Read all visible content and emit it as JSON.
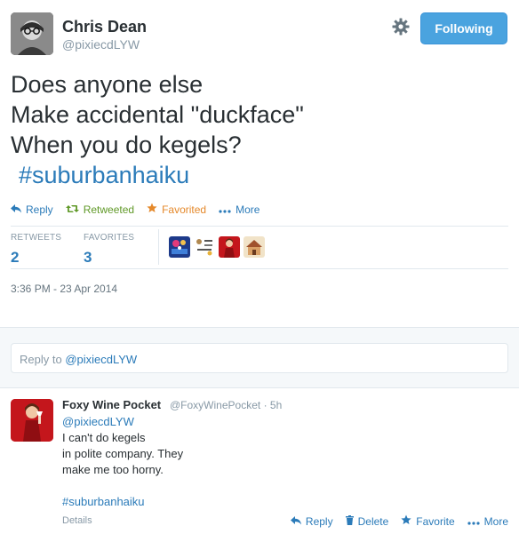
{
  "tweet": {
    "author_name": "Chris Dean",
    "author_handle": "@pixiecdLYW",
    "follow_label": "Following",
    "text_lines": [
      "Does anyone else",
      "Make accidental \"duckface\"",
      "When you do kegels?"
    ],
    "hashtag": "#suburbanhaiku",
    "actions": {
      "reply": "Reply",
      "retweet": "Retweeted",
      "favorite": "Favorited",
      "more": "More"
    },
    "stats": {
      "retweets_label": "RETWEETS",
      "retweets_count": "2",
      "favorites_label": "FAVORITES",
      "favorites_count": "3"
    },
    "timestamp": "3:36 PM - 23 Apr 2014"
  },
  "reply_box": {
    "prefix": "Reply to ",
    "mention": "@pixiecdLYW"
  },
  "reply": {
    "author_name": "Foxy Wine Pocket",
    "author_handle": "@FoxyWinePocket",
    "time": "5h",
    "separator": "·",
    "mention": "@pixiecdLYW",
    "text_lines": [
      "I can't do kegels",
      "in polite company. They",
      "make me too horny."
    ],
    "hashtag": "#suburbanhaiku",
    "details_label": "Details",
    "actions": {
      "reply": "Reply",
      "delete": "Delete",
      "favorite": "Favorite",
      "more": "More"
    }
  },
  "colors": {
    "link": "#2b7bb9",
    "retweet": "#609928",
    "favorite": "#e5892b",
    "follow_button": "#4aa3df",
    "muted": "#8899a6"
  },
  "icons": {
    "gear": "gear-icon",
    "reply": "reply-arrow-icon",
    "retweet": "retweet-icon",
    "favorite": "star-icon",
    "more": "ellipsis-icon",
    "delete": "trash-icon"
  }
}
